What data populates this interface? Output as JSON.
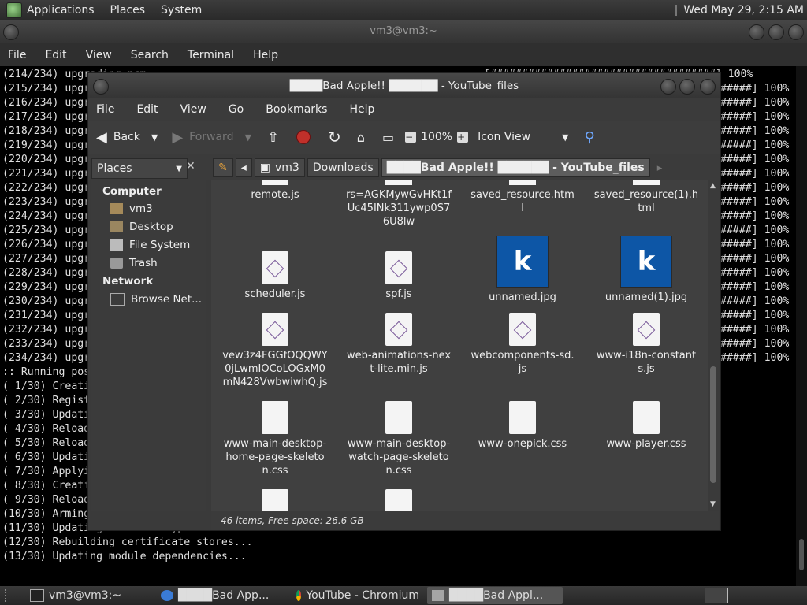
{
  "top_panel": {
    "menus": [
      "Applications",
      "Places",
      "System"
    ],
    "clock": "Wed May 29,  2:15 AM"
  },
  "terminal": {
    "title": "vm3@vm3:~",
    "menus": [
      "File",
      "Edit",
      "View",
      "Search",
      "Terminal",
      "Help"
    ],
    "progress_lines": [
      "(214/234) upgrading ncm",
      "(215/234) upgr",
      "(216/234) upgr",
      "(217/234) upgr",
      "(218/234) upgr",
      "(219/234) upgr",
      "(220/234) upgr",
      "(221/234) upgr",
      "(222/234) upgr",
      "(223/234) upgr",
      "(224/234) upgr",
      "(225/234) upgr",
      "(226/234) upgr",
      "(227/234) upgr",
      "(228/234) upgr",
      "(229/234) upgr",
      "(230/234) upgr",
      "(231/234) upgr",
      "(232/234) upgr",
      "(233/234) upgr",
      "(234/234) upgr"
    ],
    "right_lines": [
      "[####################################] 100%",
      "#####] 100%",
      "#####] 100%",
      "#####] 100%",
      "#####] 100%",
      "#####] 100%",
      "#####] 100%",
      "#####] 100%",
      "#####] 100%",
      "#####] 100%",
      "#####] 100%",
      "#####] 100%",
      "#####] 100%",
      "#####] 100%",
      "#####] 100%",
      "#####] 100%",
      "#####] 100%",
      "#####] 100%",
      "#####] 100%",
      "#####] 100%",
      "#####] 100%"
    ],
    "hook_lines": [
      ":: Running pos",
      "( 1/30) Creati",
      "( 2/30) Regist",
      "( 3/30) Updati",
      "( 4/30) Reload",
      "( 5/30) Reload",
      "( 6/30) Updati",
      "( 7/30) Applyi",
      "( 8/30) Creati",
      "( 9/30) Reload",
      "(10/30) Arming",
      "(11/30) Updating the MIME type database...",
      "(12/30) Rebuilding certificate stores...",
      "(13/30) Updating module dependencies..."
    ]
  },
  "file_manager": {
    "title": "████Bad Apple!! ██████ - YouTube_files",
    "menus": [
      "File",
      "Edit",
      "View",
      "Go",
      "Bookmarks",
      "Help"
    ],
    "toolbar": {
      "back": "Back",
      "forward": "Forward",
      "zoom": "100%",
      "view_mode": "Icon View"
    },
    "places_combo": "Places",
    "sidebar": {
      "computer_heading": "Computer",
      "computer_items": [
        "vm3",
        "Desktop",
        "File System",
        "Trash"
      ],
      "network_heading": "Network",
      "network_items": [
        "Browse Net..."
      ]
    },
    "path": [
      "vm3",
      "Downloads",
      "████Bad Apple!! ██████ - YouTube_files"
    ],
    "files": [
      {
        "name": "remote.js",
        "kind": "js"
      },
      {
        "name": "rs=AGKMywGvHKt1fUc45INk311ywp0S76U8lw",
        "kind": "js"
      },
      {
        "name": "saved_resource.html",
        "kind": "html"
      },
      {
        "name": "saved_resource(1).html",
        "kind": "html"
      },
      {
        "name": "scheduler.js",
        "kind": "js"
      },
      {
        "name": "spf.js",
        "kind": "js"
      },
      {
        "name": "unnamed.jpg",
        "kind": "image",
        "thumb_letter": "k"
      },
      {
        "name": "unnamed(1).jpg",
        "kind": "image",
        "thumb_letter": "k"
      },
      {
        "name": "vew3z4FGGfOQQWY0jLwmIOCoLOGxM0mN428VwbwiwhQ.js",
        "kind": "js"
      },
      {
        "name": "web-animations-next-lite.min.js",
        "kind": "js"
      },
      {
        "name": "webcomponents-sd.js",
        "kind": "js"
      },
      {
        "name": "www-i18n-constants.js",
        "kind": "js"
      },
      {
        "name": "www-main-desktop-home-page-skeleton.css",
        "kind": "css"
      },
      {
        "name": "www-main-desktop-watch-page-skeleton.css",
        "kind": "css"
      },
      {
        "name": "www-onepick.css",
        "kind": "css"
      },
      {
        "name": "www-player.css",
        "kind": "css"
      }
    ],
    "status": "46 items, Free space: 26.6 GB"
  },
  "taskbar": {
    "tasks": [
      "vm3@vm3:~",
      "████Bad App...",
      "YouTube - Chromium",
      "████Bad Appl..."
    ]
  },
  "colors": {
    "terminal_bg": "#000000",
    "window_bg": "#3a3a3a",
    "image_thumb": "#0d56a6"
  }
}
